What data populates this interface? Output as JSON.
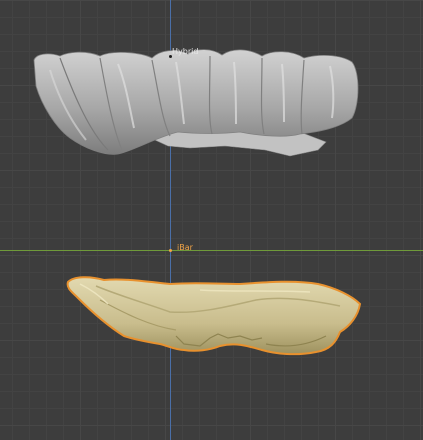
{
  "viewport": {
    "objects": [
      {
        "name": "Hybrid",
        "selected": false
      },
      {
        "name": "iBar",
        "selected": true
      }
    ],
    "colors": {
      "background": "#3d3d3d",
      "grid": "#474747",
      "x_axis": "#6f9a3a",
      "z_axis": "#4a6fa8",
      "selection_outline": "#e8912e",
      "mesh_grey": "#b4b4b4",
      "mesh_cream": "#d2c79c"
    },
    "icons": [
      "hybrid-dentition-mesh",
      "ibar-mesh",
      "object-origin-dot"
    ]
  }
}
